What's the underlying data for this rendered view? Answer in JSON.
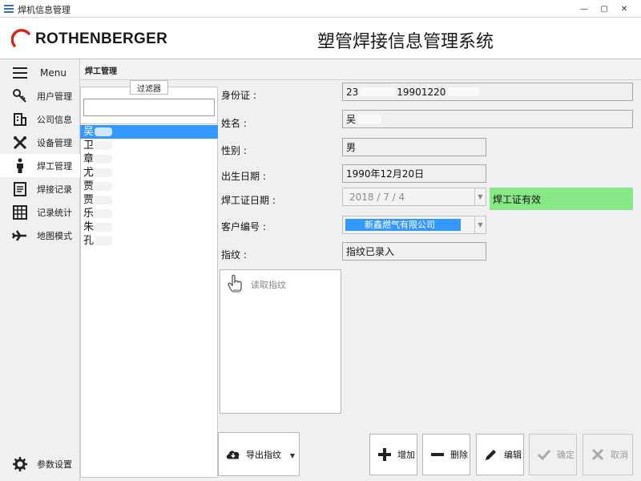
{
  "window": {
    "title": "焊机信息管理",
    "minimize": "—",
    "restore": "▢",
    "close": "✕"
  },
  "header": {
    "logo_text": "ROTHENBERGER",
    "app_title": "塑管焊接信息管理系统"
  },
  "sidebar": {
    "menu_label": "Menu",
    "items": [
      {
        "label": "用户管理",
        "icon": "key-icon"
      },
      {
        "label": "公司信息",
        "icon": "building-icon"
      },
      {
        "label": "设备管理",
        "icon": "tools-icon"
      },
      {
        "label": "焊工管理",
        "icon": "person-icon",
        "active": true
      },
      {
        "label": "焊接记录",
        "icon": "document-icon"
      },
      {
        "label": "记录统计",
        "icon": "calculator-icon"
      },
      {
        "label": "地图模式",
        "icon": "airplane-icon"
      }
    ],
    "settings_label": "参数设置"
  },
  "breadcrumb": "焊工管理",
  "filter": {
    "label": "过滤器",
    "value": ""
  },
  "welders": [
    "吴",
    "卫",
    "章",
    "尤",
    "贾",
    "贾",
    "乐",
    "朱",
    "孔"
  ],
  "selected_welder_index": 0,
  "form": {
    "id_label": "身份证 :",
    "id_prefix": "23",
    "id_middle": "19901220",
    "name_label": "姓名 :",
    "name_value": "吴",
    "gender_label": "性别 :",
    "gender_value": "男",
    "birth_label": "出生日期 :",
    "birth_value": "1990年12月20日",
    "cert_label": "焊工证日期 :",
    "cert_value": "2018 / 7 / 4",
    "cert_status": "焊工证有效",
    "customer_label": "客户编号 :",
    "customer_value": "新鑫燃气有限公司",
    "fingerprint_label": "指纹 :",
    "fingerprint_value": "指纹已录入",
    "read_fp_label": "读取指纹"
  },
  "buttons": {
    "export": "导出指纹",
    "add": "增加",
    "delete": "删除",
    "edit": "编辑",
    "confirm": "确定",
    "cancel": "取消"
  },
  "colors": {
    "brand_red": "#d4271f",
    "accent_blue": "#3399ff",
    "status_green": "#88e888"
  }
}
